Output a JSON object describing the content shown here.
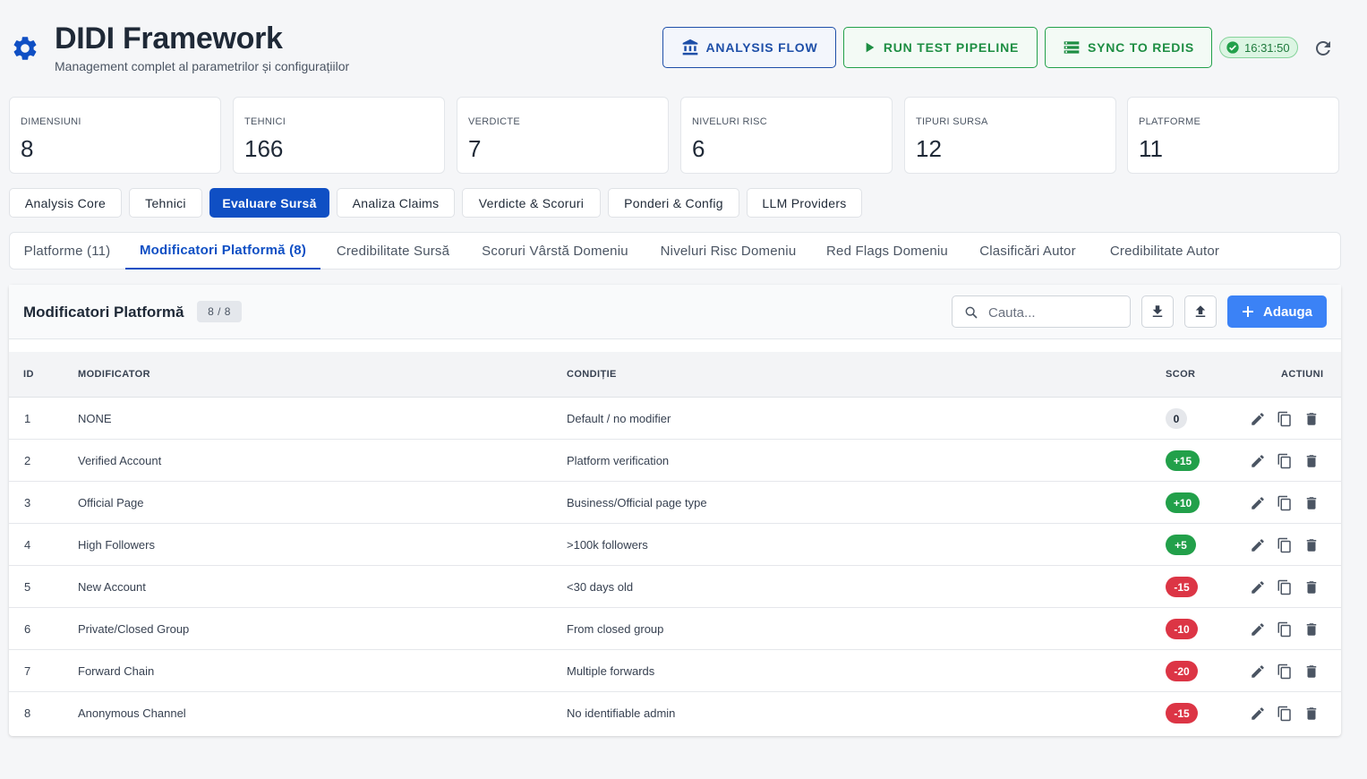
{
  "header": {
    "title": "DIDI Framework",
    "subtitle": "Management complet al parametrilor și configurațiilor",
    "buttons": {
      "analysis_flow": "ANALYSIS FLOW",
      "run_test": "RUN TEST PIPELINE",
      "sync_redis": "SYNC TO REDIS"
    },
    "time": "16:31:50"
  },
  "stats": [
    {
      "label": "DIMENSIUNI",
      "value": "8"
    },
    {
      "label": "TEHNICI",
      "value": "166"
    },
    {
      "label": "VERDICTE",
      "value": "7"
    },
    {
      "label": "NIVELURI RISC",
      "value": "6"
    },
    {
      "label": "TIPURI SURSA",
      "value": "12"
    },
    {
      "label": "PLATFORME",
      "value": "11"
    }
  ],
  "main_tabs": [
    {
      "label": "Analysis Core"
    },
    {
      "label": "Tehnici"
    },
    {
      "label": "Evaluare Sursă"
    },
    {
      "label": "Analiza Claims"
    },
    {
      "label": "Verdicte & Scoruri"
    },
    {
      "label": "Ponderi & Config"
    },
    {
      "label": "LLM Providers"
    }
  ],
  "sub_tabs": [
    {
      "label": "Platforme (11)"
    },
    {
      "label": "Modificatori Platformă (8)"
    },
    {
      "label": "Credibilitate Sursă"
    },
    {
      "label": "Scoruri Vârstă Domeniu"
    },
    {
      "label": "Niveluri Risc Domeniu"
    },
    {
      "label": "Red Flags Domeniu"
    },
    {
      "label": "Clasificări Autor"
    },
    {
      "label": "Credibilitate Autor"
    }
  ],
  "panel": {
    "title": "Modificatori Platformă",
    "count": "8 / 8",
    "search_placeholder": "Cauta...",
    "add_label": "Adauga"
  },
  "table": {
    "columns": {
      "id": "ID",
      "modifier": "MODIFICATOR",
      "condition": "CONDIȚIE",
      "score": "SCOR",
      "actions": "ACTIUNI"
    },
    "rows": [
      {
        "id": "1",
        "modifier": "NONE",
        "condition": "Default / no modifier",
        "score": "0"
      },
      {
        "id": "2",
        "modifier": "Verified Account",
        "condition": "Platform verification",
        "score": "+15"
      },
      {
        "id": "3",
        "modifier": "Official Page",
        "condition": "Business/Official page type",
        "score": "+10"
      },
      {
        "id": "4",
        "modifier": "High Followers",
        "condition": ">100k followers",
        "score": "+5"
      },
      {
        "id": "5",
        "modifier": "New Account",
        "condition": "<30 days old",
        "score": "-15"
      },
      {
        "id": "6",
        "modifier": "Private/Closed Group",
        "condition": "From closed group",
        "score": "-10"
      },
      {
        "id": "7",
        "modifier": "Forward Chain",
        "condition": "Multiple forwards",
        "score": "-20"
      },
      {
        "id": "8",
        "modifier": "Anonymous Channel",
        "condition": "No identifiable admin",
        "score": "-15"
      }
    ]
  },
  "colors": {
    "primary": "#0f4fc4",
    "add_button": "#3b82f6",
    "positive": "#22a04a",
    "negative": "#dc3545"
  }
}
